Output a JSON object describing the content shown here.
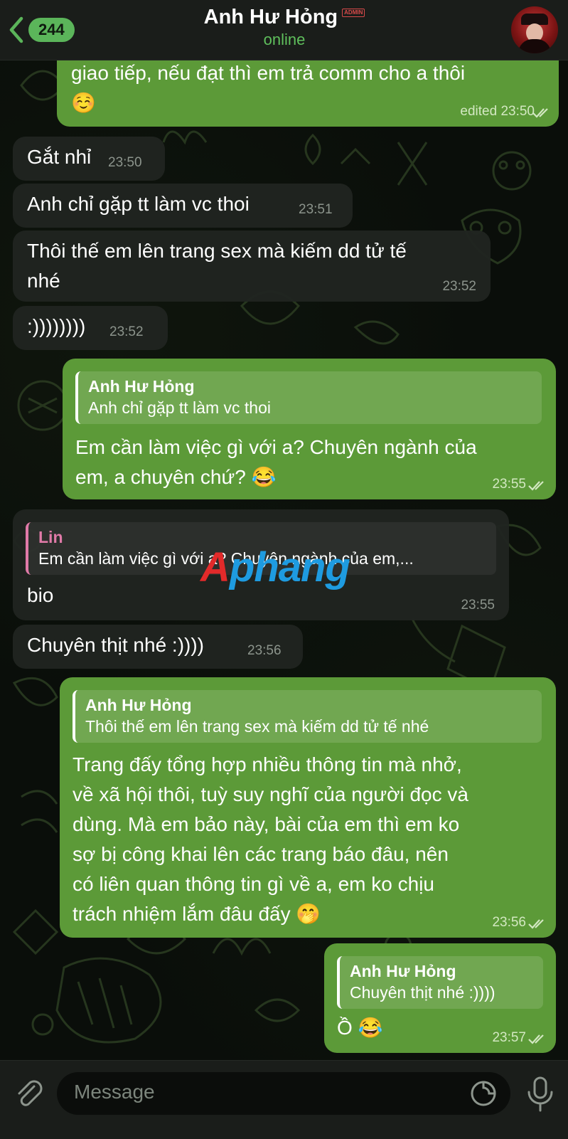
{
  "header": {
    "back_count": "244",
    "title": "Anh Hư Hỏng",
    "admin_badge": "ADMIN",
    "status": "online",
    "icons": {
      "back": "chevron-left-icon",
      "avatar": "avatar"
    }
  },
  "messages": [
    {
      "direction": "outgoing",
      "text_lines": [
        "giao tiếp, nếu đạt thì em trả comm cho a thôi",
        "☺️"
      ],
      "time": "edited 23:50",
      "read": true
    },
    {
      "direction": "incoming",
      "text": "Gắt nhỉ",
      "time": "23:50"
    },
    {
      "direction": "incoming",
      "text": "Anh chỉ gặp tt làm vc thoi",
      "time": "23:51"
    },
    {
      "direction": "incoming",
      "text_lines": [
        "Thôi thế em lên trang sex mà kiếm dd tử tế",
        "nhé"
      ],
      "time": "23:52"
    },
    {
      "direction": "incoming",
      "text": ":))))))))",
      "time": "23:52"
    },
    {
      "direction": "outgoing",
      "reply": {
        "name": "Anh Hư Hỏng",
        "text": "Anh chỉ gặp tt làm vc thoi"
      },
      "text_lines": [
        "Em cần làm việc gì với a? Chuyên ngành của",
        "em, a chuyên chứ? 😂"
      ],
      "time": "23:55",
      "read": true
    },
    {
      "direction": "incoming",
      "reply": {
        "name": "Lin",
        "text": "Em cần làm việc gì với a? Chuyên ngành của em,..."
      },
      "text": "bio",
      "time": "23:55"
    },
    {
      "direction": "incoming",
      "text": "Chuyên thịt nhé :))))",
      "time": "23:56"
    },
    {
      "direction": "outgoing",
      "reply": {
        "name": "Anh Hư Hỏng",
        "text": "Thôi thế em lên trang sex mà kiếm dd tử tế nhé"
      },
      "text_lines": [
        "Trang đấy tổng hợp nhiều thông tin mà nhở,",
        "về xã hội thôi, tuỳ suy nghĩ của người đọc và",
        "dùng. Mà em bảo này, bài của em thì em ko",
        "sợ bị công khai lên các trang báo đâu, nên",
        "có liên quan thông tin gì về a, em ko chịu",
        "trách nhiệm lắm đâu đấy 🤭"
      ],
      "time": "23:56",
      "read": true
    },
    {
      "direction": "outgoing",
      "reply": {
        "name": "Anh Hư Hỏng",
        "text": "Chuyên thịt nhé :))))"
      },
      "text": "Ồ 😂",
      "time": "23:57",
      "read": true
    }
  ],
  "watermark": {
    "first": "A",
    "rest": "phang"
  },
  "composer": {
    "placeholder": "Message",
    "icons": {
      "attach": "paperclip-icon",
      "sticker": "sticker-icon",
      "mic": "microphone-icon"
    }
  },
  "colors": {
    "outgoing_bubble": "#5c9a38",
    "incoming_bubble": "#202420",
    "accent": "#5bb55a",
    "reply_name_incoming": "#e07aa8"
  }
}
